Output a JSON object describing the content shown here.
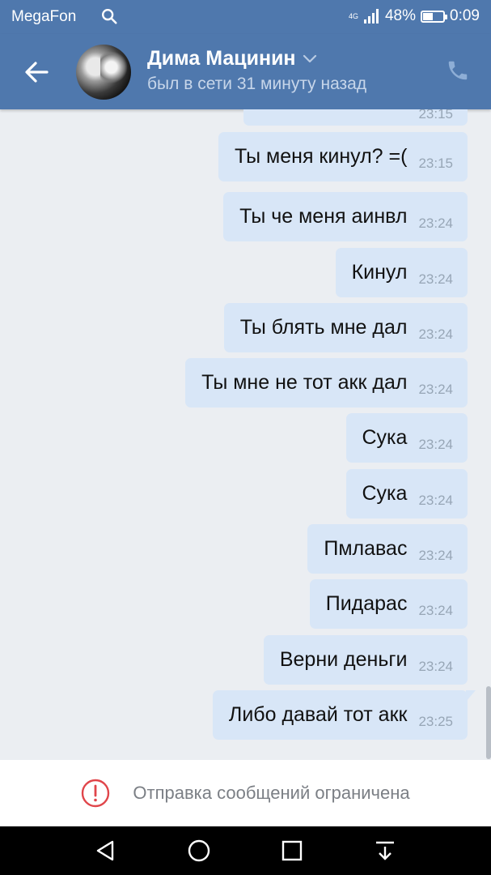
{
  "status_bar": {
    "carrier": "MegaFon",
    "network": "4G",
    "battery": "48%",
    "battery_level": 0.48,
    "time": "0:09",
    "icons": [
      "search-icon",
      "signal-icon",
      "battery-icon"
    ]
  },
  "header": {
    "name": "Дима Мацинин",
    "last_seen": "был в сети 31 минуту назад",
    "icons": [
      "back-arrow-icon",
      "avatar",
      "chevron-down-icon",
      "phone-icon"
    ]
  },
  "messages": [
    {
      "text": "",
      "time": "23:15"
    },
    {
      "text": "Ты меня кинул? =(",
      "time": "23:15"
    },
    {
      "text": "Ты че меня аинвл",
      "time": "23:24"
    },
    {
      "text": "Кинул",
      "time": "23:24"
    },
    {
      "text": "Ты блять мне дал",
      "time": "23:24"
    },
    {
      "text": "Ты мне не тот акк дал",
      "time": "23:24"
    },
    {
      "text": "Сука",
      "time": "23:24"
    },
    {
      "text": "Сука",
      "time": "23:24"
    },
    {
      "text": "Пмлавас",
      "time": "23:24"
    },
    {
      "text": "Пидарас",
      "time": "23:24"
    },
    {
      "text": "Верни деньги",
      "time": "23:24"
    },
    {
      "text": "Либо давай тот акк",
      "time": "23:25"
    }
  ],
  "restriction": {
    "text": "Отправка сообщений ограничена",
    "icon": "alert-circle-icon"
  },
  "nav_bar": {
    "icons": [
      "back-triangle-icon",
      "home-circle-icon",
      "recents-square-icon",
      "notifications-pull-icon"
    ]
  },
  "colors": {
    "header": "#4f78ad",
    "bubble": "#d8e6f7",
    "background": "#ebeef2",
    "alert": "#e0454a"
  }
}
